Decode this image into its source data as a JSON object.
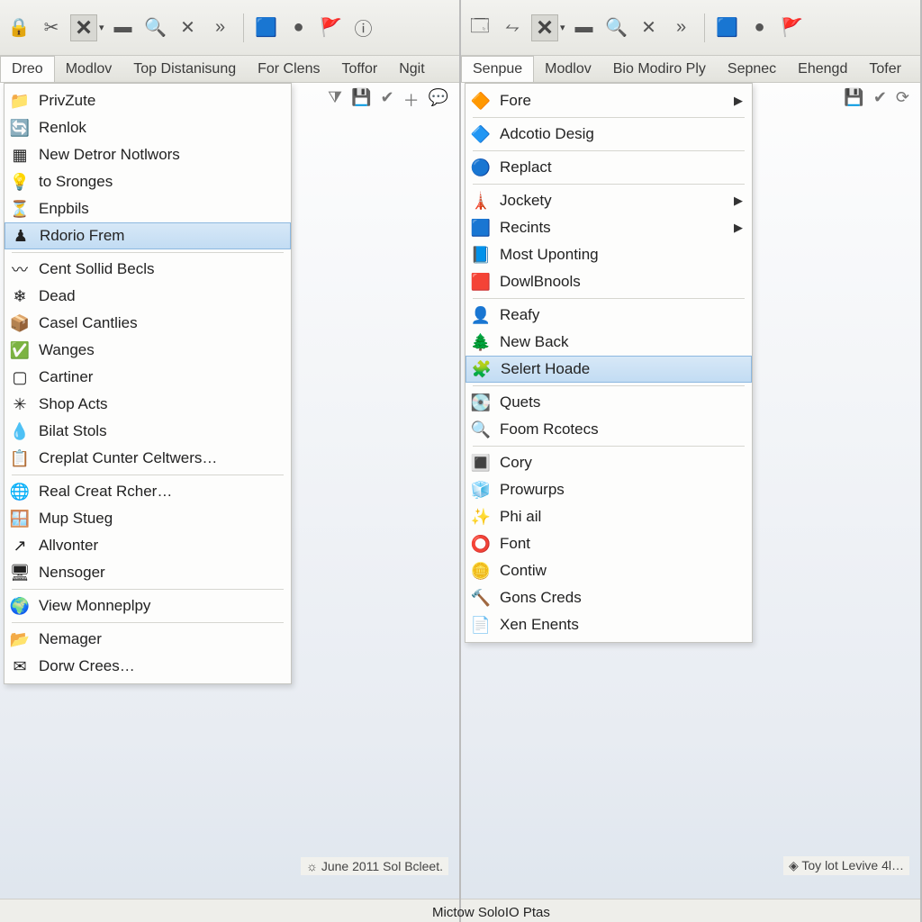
{
  "left": {
    "menubar": [
      "Dreo",
      "Modlov",
      "Top Distanisung",
      "For Clens",
      "Toffor",
      "Ngit"
    ],
    "active_menu_index": 0,
    "menu": {
      "groups": [
        [
          {
            "icon": "folder-icon",
            "label": "PrivZute"
          },
          {
            "icon": "globe-arrow-icon",
            "label": "Renlok"
          },
          {
            "icon": "grid-icon",
            "label": "New Detror Notlwors"
          },
          {
            "icon": "bulb-icon",
            "label": "to Sronges"
          },
          {
            "icon": "funnel-icon",
            "label": "Enpbils"
          },
          {
            "icon": "stand-icon",
            "label": "Rdorio Frem",
            "highlight": true
          }
        ],
        [
          {
            "icon": "curve-icon",
            "label": "Cent Sollid Becls"
          },
          {
            "icon": "snow-icon",
            "label": "Dead"
          },
          {
            "icon": "box-icon",
            "label": "Casel Cantlies"
          },
          {
            "icon": "check-green-icon",
            "label": "Wanges"
          },
          {
            "icon": "square-icon",
            "label": "Cartiner"
          },
          {
            "icon": "star-icon",
            "label": "Shop Acts"
          },
          {
            "icon": "drop-icon",
            "label": "Bilat Stols"
          },
          {
            "icon": "clipboard-icon",
            "label": "Creplat Cunter Celtwers…"
          }
        ],
        [
          {
            "icon": "globe-icon",
            "label": "Real Creat Rcher…"
          },
          {
            "icon": "window-icon",
            "label": "Mup Stueg"
          },
          {
            "icon": "diag-icon",
            "label": "Allvonter"
          },
          {
            "icon": "display-icon",
            "label": "Nensoger"
          }
        ],
        [
          {
            "icon": "world-icon",
            "label": "View Monneplpy"
          }
        ],
        [
          {
            "icon": "folder2-icon",
            "label": "Nemager"
          },
          {
            "icon": "mail-icon",
            "label": "Dorw Crees…"
          }
        ]
      ]
    },
    "status": "June 2011 Sol Bcleet."
  },
  "right": {
    "menubar": [
      "Senpue",
      "Modlov",
      "Bio Modiro Ply",
      "Sepnec",
      "Ehengd",
      "Tofer"
    ],
    "active_menu_index": 0,
    "menu": {
      "groups": [
        [
          {
            "icon": "diamond-green-icon",
            "label": "Fore",
            "submenu": true
          }
        ],
        [
          {
            "icon": "diamond-grey-icon",
            "label": "Adcotio Desig"
          }
        ],
        [
          {
            "icon": "sphere-icon",
            "label": "Replact"
          }
        ],
        [
          {
            "icon": "tower-icon",
            "label": "Jockety",
            "submenu": true
          },
          {
            "icon": "bluebox-icon",
            "label": "Recints",
            "submenu": true
          },
          {
            "icon": "panel-icon",
            "label": "Most Uponting"
          },
          {
            "icon": "redbox-icon",
            "label": "DowlBnools"
          }
        ],
        [
          {
            "icon": "person-icon",
            "label": "Reafy"
          },
          {
            "icon": "tree-icon",
            "label": "New Back"
          },
          {
            "icon": "robot-icon",
            "label": "Selert Hoade",
            "highlight": true
          }
        ],
        [
          {
            "icon": "disk-icon",
            "label": "Quets"
          },
          {
            "icon": "magnify-icon",
            "label": "Foom Rcotecs"
          }
        ],
        [
          {
            "icon": "grid2-icon",
            "label": "Cory"
          },
          {
            "icon": "cube-icon",
            "label": "Prowurps"
          },
          {
            "icon": "sparkle-icon",
            "label": "Phi ail"
          },
          {
            "icon": "ring-icon",
            "label": "Font"
          },
          {
            "icon": "coin-icon",
            "label": "Contiw"
          },
          {
            "icon": "hammer-icon",
            "label": "Gons Creds"
          },
          {
            "icon": "page-icon",
            "label": "Xen Enents"
          }
        ]
      ]
    },
    "status": "Toy lot Levive 4l…"
  },
  "global_status": "Mictow SoloIO Ptas",
  "icon_glyphs": {
    "folder-icon": "📁",
    "globe-arrow-icon": "🔄",
    "grid-icon": "▦",
    "bulb-icon": "💡",
    "funnel-icon": "⏳",
    "stand-icon": "♟",
    "curve-icon": "〰",
    "snow-icon": "❄",
    "box-icon": "📦",
    "check-green-icon": "✅",
    "square-icon": "▢",
    "star-icon": "✳",
    "drop-icon": "💧",
    "clipboard-icon": "📋",
    "globe-icon": "🌐",
    "window-icon": "🪟",
    "diag-icon": "↗",
    "display-icon": "🖥",
    "world-icon": "🌍",
    "folder2-icon": "📂",
    "mail-icon": "✉",
    "diamond-green-icon": "🔶",
    "diamond-grey-icon": "🔷",
    "sphere-icon": "🔵",
    "tower-icon": "🗼",
    "bluebox-icon": "🟦",
    "panel-icon": "📘",
    "redbox-icon": "🟥",
    "person-icon": "👤",
    "tree-icon": "🌲",
    "robot-icon": "🧩",
    "disk-icon": "💽",
    "magnify-icon": "🔍",
    "grid2-icon": "🔳",
    "cube-icon": "🧊",
    "sparkle-icon": "✨",
    "ring-icon": "⭕",
    "coin-icon": "🪙",
    "hammer-icon": "🔨",
    "page-icon": "📄"
  }
}
